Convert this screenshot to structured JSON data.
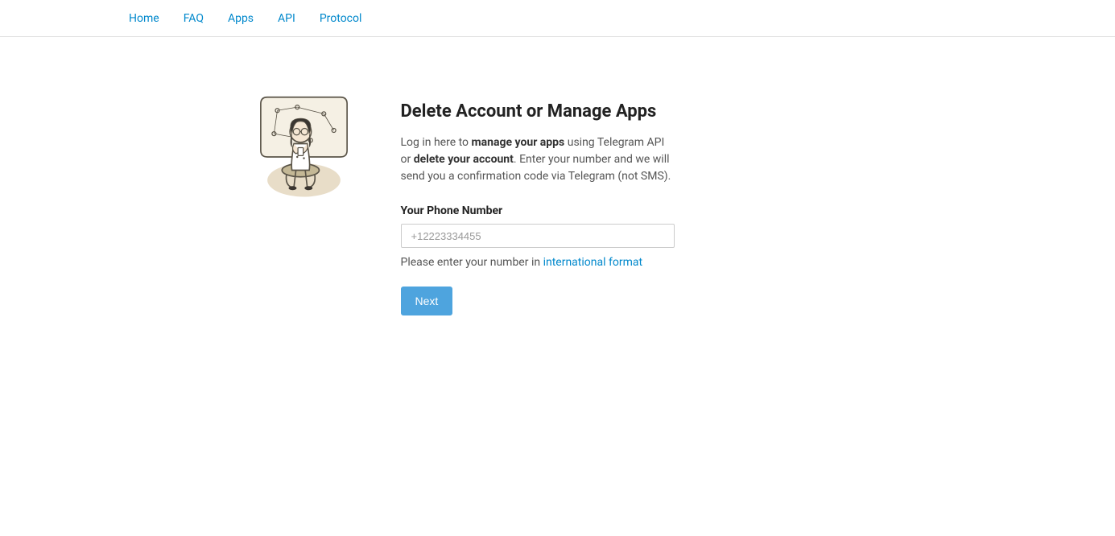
{
  "nav": {
    "home": "Home",
    "faq": "FAQ",
    "apps": "Apps",
    "api": "API",
    "protocol": "Protocol"
  },
  "main": {
    "heading": "Delete Account or Manage Apps",
    "desc_p1": "Log in here to ",
    "desc_strong1": "manage your apps",
    "desc_p2": " using Telegram API or ",
    "desc_strong2": "delete your account",
    "desc_p3": ". Enter your number and we will send you a confirmation code via Telegram (not SMS).",
    "phone_label": "Your Phone Number",
    "phone_placeholder": "+12223334455",
    "phone_value": "",
    "help_text": "Please enter your number in ",
    "help_link": "international format",
    "next_button": "Next"
  }
}
